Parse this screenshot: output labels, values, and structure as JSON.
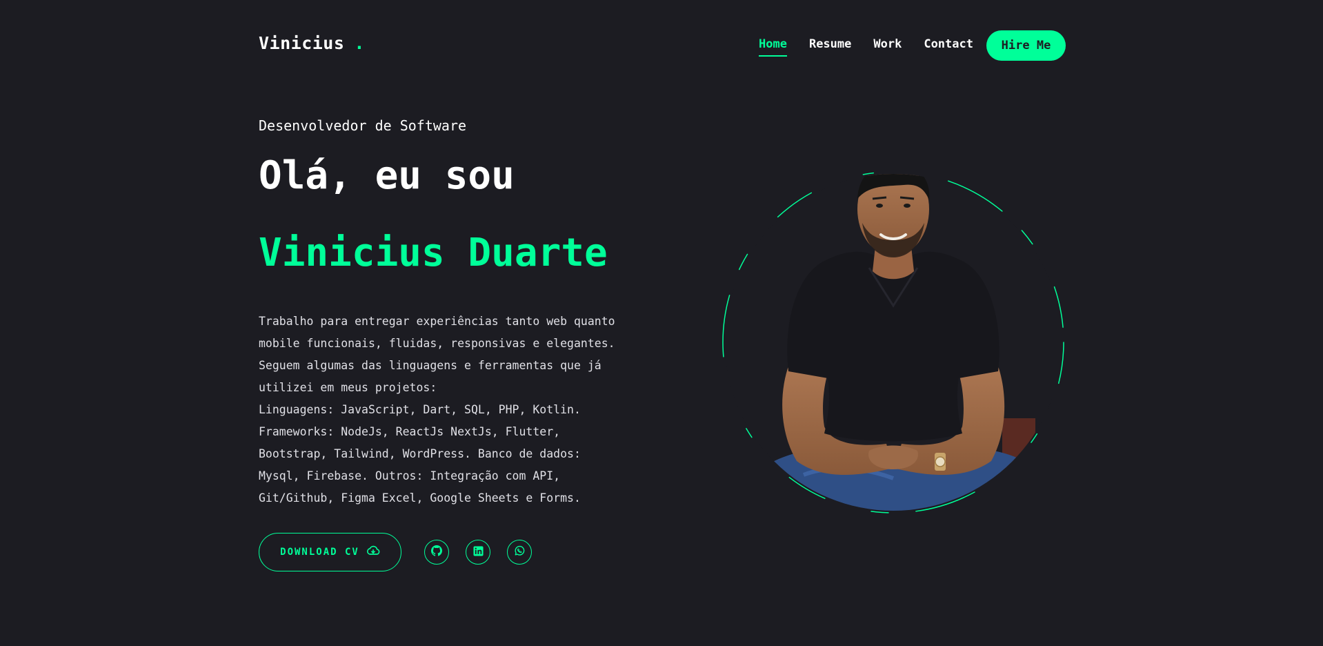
{
  "header": {
    "logo_text": "Vinicius",
    "logo_dot": ".",
    "nav": [
      {
        "label": "Home",
        "active": true
      },
      {
        "label": "Resume",
        "active": false
      },
      {
        "label": "Work",
        "active": false
      },
      {
        "label": "Contact",
        "active": false
      }
    ],
    "hire_label": "Hire Me"
  },
  "hero": {
    "role": "Desenvolvedor de Software",
    "greeting": "Olá, eu sou",
    "name": "Vinicius Duarte",
    "description": [
      "Trabalho para entregar experiências tanto web quanto",
      "mobile funcionais, fluidas, responsivas e elegantes.",
      "Seguem algumas das linguagens e ferramentas que já",
      "utilizei em meus projetos:",
      "Linguagens: JavaScript, Dart, SQL, PHP, Kotlin.",
      "Frameworks: NodeJs, ReactJs NextJs, Flutter,",
      "Bootstrap, Tailwind, WordPress. Banco de dados:",
      "Mysql, Firebase. Outros: Integração com API,",
      "Git/Github, Figma Excel, Google Sheets e Forms."
    ],
    "download_label": "DOWNLOAD CV",
    "socials": [
      "github-icon",
      "linkedin-icon",
      "whatsapp-icon"
    ]
  },
  "colors": {
    "background": "#1c1c22",
    "accent": "#00ff99",
    "text": "#ffffff"
  }
}
